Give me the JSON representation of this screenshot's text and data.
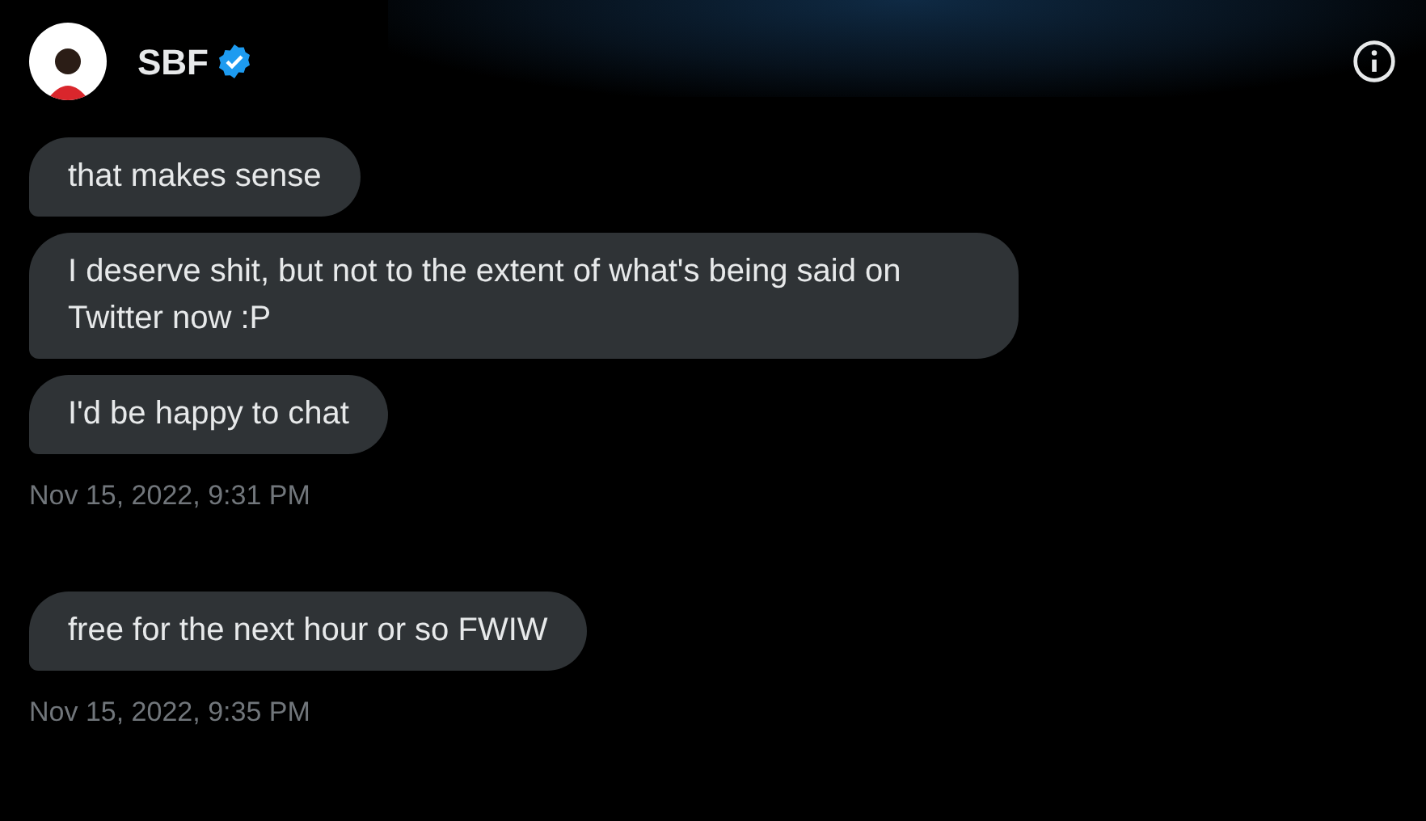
{
  "header": {
    "name": "SBF",
    "verified": true
  },
  "messages": [
    {
      "kind": "message",
      "text": "that makes sense"
    },
    {
      "kind": "message",
      "text": "I deserve shit, but not to the extent of what's being said on Twitter now :P"
    },
    {
      "kind": "message",
      "text": "I'd be happy to chat"
    },
    {
      "kind": "timestamp",
      "text": "Nov 15, 2022, 9:31 PM"
    },
    {
      "kind": "message",
      "text": "free for the next hour or so FWIW"
    },
    {
      "kind": "timestamp",
      "text": "Nov 15, 2022, 9:35 PM"
    }
  ]
}
